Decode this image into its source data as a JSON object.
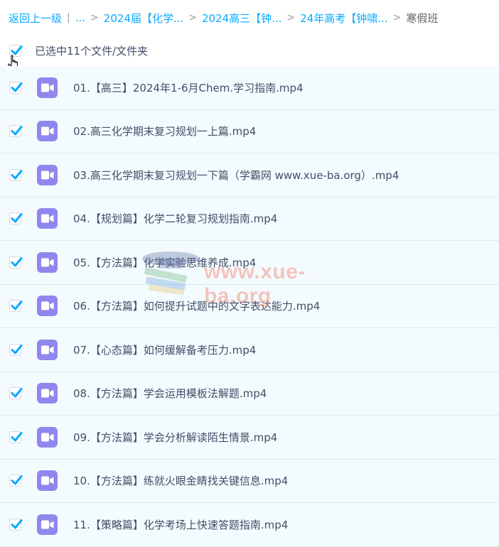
{
  "breadcrumb": {
    "items": [
      {
        "label": "返回上一级"
      },
      {
        "label": "..."
      },
      {
        "label": "2024届【化学..."
      },
      {
        "label": "2024高三【钟..."
      },
      {
        "label": "24年高考【钟啸..."
      }
    ],
    "divider": "|",
    "separator": ">",
    "current": "寒假班"
  },
  "selection": {
    "label": "已选中11个文件/文件夹",
    "checked": true
  },
  "files": [
    {
      "name": "01.【高三】2024年1-6月Chem.学习指南.mp4",
      "checked": true,
      "icon": "video-icon"
    },
    {
      "name": "02.高三化学期末复习规划一上篇.mp4",
      "checked": true,
      "icon": "video-icon"
    },
    {
      "name": "03.高三化学期末复习规划一下篇（学霸网 www.xue-ba.org）.mp4",
      "checked": true,
      "icon": "video-icon"
    },
    {
      "name": "04.【规划篇】化学二轮复习规划指南.mp4",
      "checked": true,
      "icon": "video-icon"
    },
    {
      "name": "05.【方法篇】化学实验思维养成.mp4",
      "checked": true,
      "icon": "video-icon"
    },
    {
      "name": "06.【方法篇】如何提升试题中的文字表达能力.mp4",
      "checked": true,
      "icon": "video-icon"
    },
    {
      "name": "07.【心态篇】如何缓解备考压力.mp4",
      "checked": true,
      "icon": "video-icon"
    },
    {
      "name": "08.【方法篇】学会运用模板法解题.mp4",
      "checked": true,
      "icon": "video-icon"
    },
    {
      "name": "09.【方法篇】学会分析解读陌生情景.mp4",
      "checked": true,
      "icon": "video-icon"
    },
    {
      "name": "10.【方法篇】练就火眼金睛找关键信息.mp4",
      "checked": true,
      "icon": "video-icon"
    },
    {
      "name": "11.【策略篇】化学考场上快速答题指南.mp4",
      "checked": true,
      "icon": "video-icon"
    }
  ],
  "watermark": {
    "text": "www.xue-ba.org"
  },
  "colors": {
    "link": "#09aaff",
    "checkbox": "#09aaff",
    "video_icon": "#9087ee",
    "row_bg": "#f4fbff"
  }
}
